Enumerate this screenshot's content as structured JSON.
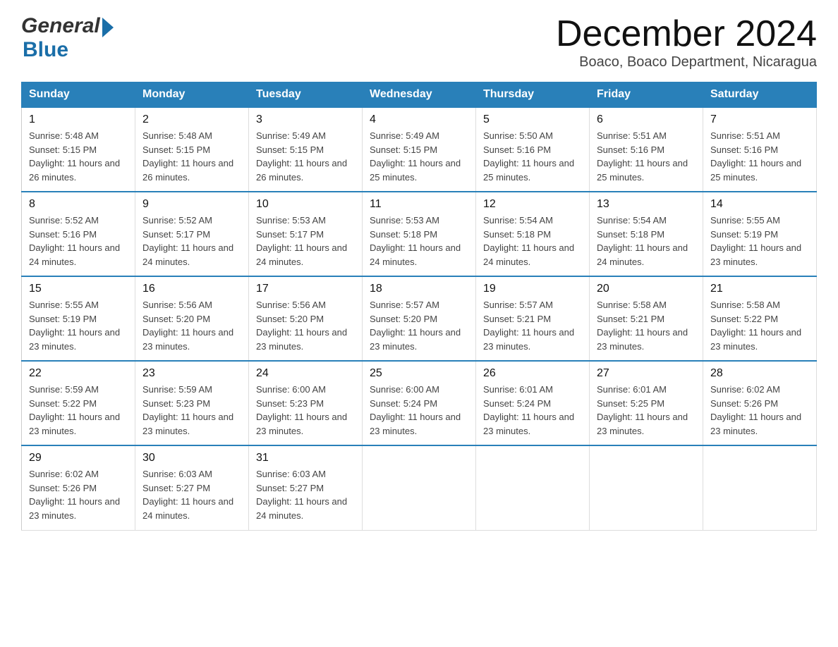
{
  "header": {
    "logo_general": "General",
    "logo_blue": "Blue",
    "title": "December 2024",
    "subtitle": "Boaco, Boaco Department, Nicaragua"
  },
  "days_header": [
    "Sunday",
    "Monday",
    "Tuesday",
    "Wednesday",
    "Thursday",
    "Friday",
    "Saturday"
  ],
  "weeks": [
    [
      {
        "day": "1",
        "sunrise": "5:48 AM",
        "sunset": "5:15 PM",
        "daylight": "11 hours and 26 minutes."
      },
      {
        "day": "2",
        "sunrise": "5:48 AM",
        "sunset": "5:15 PM",
        "daylight": "11 hours and 26 minutes."
      },
      {
        "day": "3",
        "sunrise": "5:49 AM",
        "sunset": "5:15 PM",
        "daylight": "11 hours and 26 minutes."
      },
      {
        "day": "4",
        "sunrise": "5:49 AM",
        "sunset": "5:15 PM",
        "daylight": "11 hours and 25 minutes."
      },
      {
        "day": "5",
        "sunrise": "5:50 AM",
        "sunset": "5:16 PM",
        "daylight": "11 hours and 25 minutes."
      },
      {
        "day": "6",
        "sunrise": "5:51 AM",
        "sunset": "5:16 PM",
        "daylight": "11 hours and 25 minutes."
      },
      {
        "day": "7",
        "sunrise": "5:51 AM",
        "sunset": "5:16 PM",
        "daylight": "11 hours and 25 minutes."
      }
    ],
    [
      {
        "day": "8",
        "sunrise": "5:52 AM",
        "sunset": "5:16 PM",
        "daylight": "11 hours and 24 minutes."
      },
      {
        "day": "9",
        "sunrise": "5:52 AM",
        "sunset": "5:17 PM",
        "daylight": "11 hours and 24 minutes."
      },
      {
        "day": "10",
        "sunrise": "5:53 AM",
        "sunset": "5:17 PM",
        "daylight": "11 hours and 24 minutes."
      },
      {
        "day": "11",
        "sunrise": "5:53 AM",
        "sunset": "5:18 PM",
        "daylight": "11 hours and 24 minutes."
      },
      {
        "day": "12",
        "sunrise": "5:54 AM",
        "sunset": "5:18 PM",
        "daylight": "11 hours and 24 minutes."
      },
      {
        "day": "13",
        "sunrise": "5:54 AM",
        "sunset": "5:18 PM",
        "daylight": "11 hours and 24 minutes."
      },
      {
        "day": "14",
        "sunrise": "5:55 AM",
        "sunset": "5:19 PM",
        "daylight": "11 hours and 23 minutes."
      }
    ],
    [
      {
        "day": "15",
        "sunrise": "5:55 AM",
        "sunset": "5:19 PM",
        "daylight": "11 hours and 23 minutes."
      },
      {
        "day": "16",
        "sunrise": "5:56 AM",
        "sunset": "5:20 PM",
        "daylight": "11 hours and 23 minutes."
      },
      {
        "day": "17",
        "sunrise": "5:56 AM",
        "sunset": "5:20 PM",
        "daylight": "11 hours and 23 minutes."
      },
      {
        "day": "18",
        "sunrise": "5:57 AM",
        "sunset": "5:20 PM",
        "daylight": "11 hours and 23 minutes."
      },
      {
        "day": "19",
        "sunrise": "5:57 AM",
        "sunset": "5:21 PM",
        "daylight": "11 hours and 23 minutes."
      },
      {
        "day": "20",
        "sunrise": "5:58 AM",
        "sunset": "5:21 PM",
        "daylight": "11 hours and 23 minutes."
      },
      {
        "day": "21",
        "sunrise": "5:58 AM",
        "sunset": "5:22 PM",
        "daylight": "11 hours and 23 minutes."
      }
    ],
    [
      {
        "day": "22",
        "sunrise": "5:59 AM",
        "sunset": "5:22 PM",
        "daylight": "11 hours and 23 minutes."
      },
      {
        "day": "23",
        "sunrise": "5:59 AM",
        "sunset": "5:23 PM",
        "daylight": "11 hours and 23 minutes."
      },
      {
        "day": "24",
        "sunrise": "6:00 AM",
        "sunset": "5:23 PM",
        "daylight": "11 hours and 23 minutes."
      },
      {
        "day": "25",
        "sunrise": "6:00 AM",
        "sunset": "5:24 PM",
        "daylight": "11 hours and 23 minutes."
      },
      {
        "day": "26",
        "sunrise": "6:01 AM",
        "sunset": "5:24 PM",
        "daylight": "11 hours and 23 minutes."
      },
      {
        "day": "27",
        "sunrise": "6:01 AM",
        "sunset": "5:25 PM",
        "daylight": "11 hours and 23 minutes."
      },
      {
        "day": "28",
        "sunrise": "6:02 AM",
        "sunset": "5:26 PM",
        "daylight": "11 hours and 23 minutes."
      }
    ],
    [
      {
        "day": "29",
        "sunrise": "6:02 AM",
        "sunset": "5:26 PM",
        "daylight": "11 hours and 23 minutes."
      },
      {
        "day": "30",
        "sunrise": "6:03 AM",
        "sunset": "5:27 PM",
        "daylight": "11 hours and 24 minutes."
      },
      {
        "day": "31",
        "sunrise": "6:03 AM",
        "sunset": "5:27 PM",
        "daylight": "11 hours and 24 minutes."
      },
      null,
      null,
      null,
      null
    ]
  ],
  "labels": {
    "sunrise": "Sunrise:",
    "sunset": "Sunset:",
    "daylight": "Daylight:"
  }
}
